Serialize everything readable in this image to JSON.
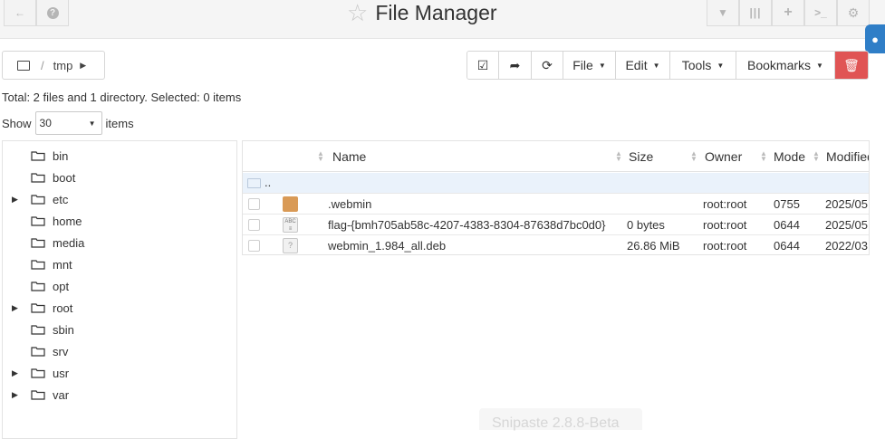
{
  "header": {
    "title": "File Manager",
    "left_buttons": [
      {
        "icon": "arrow-left-icon",
        "glyph": "🡐"
      },
      {
        "icon": "question-icon",
        "glyph": "?"
      }
    ],
    "right_buttons": [
      {
        "icon": "filter-icon",
        "glyph": "▼"
      },
      {
        "icon": "columns-icon",
        "glyph": "|||"
      },
      {
        "icon": "plus-icon",
        "glyph": "+"
      },
      {
        "icon": "terminal-icon",
        "glyph": ">_"
      },
      {
        "icon": "gear-icon",
        "glyph": "⚙"
      }
    ]
  },
  "breadcrumb": {
    "path": "tmp"
  },
  "toolbar": {
    "file_label": "File",
    "edit_label": "Edit",
    "tools_label": "Tools",
    "bookmarks_label": "Bookmarks",
    "delete_color": "#e05454"
  },
  "summary": "Total: 2 files and 1 directory. Selected: 0 items",
  "paging": {
    "show_label": "Show",
    "value": "30",
    "items_label": "items"
  },
  "tree": [
    {
      "label": "bin",
      "expandable": false
    },
    {
      "label": "boot",
      "expandable": false
    },
    {
      "label": "etc",
      "expandable": true
    },
    {
      "label": "home",
      "expandable": false
    },
    {
      "label": "media",
      "expandable": false
    },
    {
      "label": "mnt",
      "expandable": false
    },
    {
      "label": "opt",
      "expandable": false
    },
    {
      "label": "root",
      "expandable": true
    },
    {
      "label": "sbin",
      "expandable": false
    },
    {
      "label": "srv",
      "expandable": false
    },
    {
      "label": "usr",
      "expandable": true
    },
    {
      "label": "var",
      "expandable": true
    }
  ],
  "table": {
    "columns": [
      "Name",
      "Size",
      "Owner",
      "Mode",
      "Modified"
    ],
    "parent_label": "..",
    "rows": [
      {
        "type": "dir",
        "name": ".webmin",
        "size": "",
        "owner": "root:root",
        "mode": "0755",
        "modified": "2025/05"
      },
      {
        "type": "text",
        "name": "flag-{bmh705ab58c-4207-4383-8304-87638d7bc0d0}",
        "size": "0 bytes",
        "owner": "root:root",
        "mode": "0644",
        "modified": "2025/05"
      },
      {
        "type": "unknown",
        "name": "webmin_1.984_all.deb",
        "size": "26.86 MiB",
        "owner": "root:root",
        "mode": "0644",
        "modified": "2022/03"
      }
    ]
  },
  "watermark": "Snipaste 2.8.8-Beta"
}
